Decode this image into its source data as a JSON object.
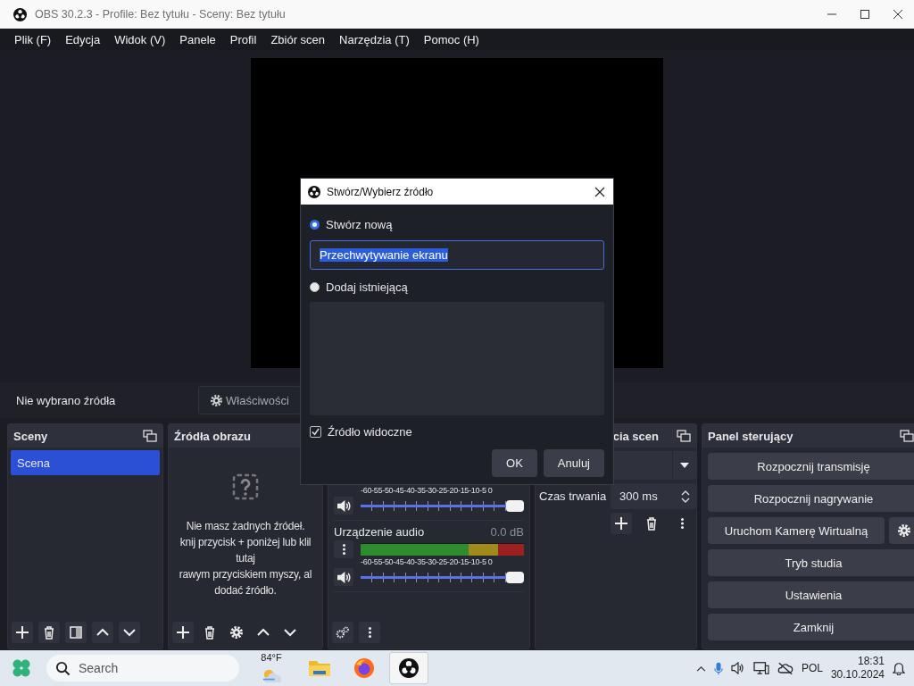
{
  "window": {
    "title": "OBS 30.2.3 - Profile: Bez tytułu - Sceny: Bez tytułu"
  },
  "menu": [
    "Plik (F)",
    "Edycja",
    "Widok (V)",
    "Panele",
    "Profil",
    "Zbiór scen",
    "Narzędzia (T)",
    "Pomoc (H)"
  ],
  "source_bar": {
    "status": "Nie wybrano źródła",
    "properties_button": "Właściwości"
  },
  "scenes": {
    "title": "Sceny",
    "items": [
      {
        "label": "Scena",
        "selected": true
      }
    ]
  },
  "sources": {
    "title": "Źródła obrazu",
    "empty_lines": [
      "Nie masz żadnych źródeł.",
      "knij przycisk + poniżej lub klil",
      "tutaj",
      "rawym przyciskiem myszy, al",
      "dodać źródło."
    ]
  },
  "mixer": {
    "channels": [
      {
        "scale": "-60-55-50-45-40-35-30-25-20-15-10-5 0",
        "level": 1
      },
      {
        "name": "Urządzenie audio",
        "reading": "0.0 dB",
        "scale": "-60-55-50-45-40-35-30-25-20-15-10-5 0",
        "level": 1
      }
    ]
  },
  "transitions": {
    "title": "cia scen",
    "duration_label": "Czas trwania",
    "duration": "300 ms"
  },
  "controls": {
    "title": "Panel sterujący",
    "buttons": [
      {
        "label": "Rozpocznij transmisję",
        "settings": false
      },
      {
        "label": "Rozpocznij nagrywanie",
        "settings": false
      },
      {
        "label": "Uruchom Kamerę Wirtualną",
        "settings": true
      },
      {
        "label": "Tryb studia",
        "settings": false
      },
      {
        "label": "Ustawienia",
        "settings": false
      },
      {
        "label": "Zamknij",
        "settings": false
      }
    ]
  },
  "dialog": {
    "title": "Stwórz/Wybierz źródło",
    "options": [
      {
        "label": "Stwórz nową",
        "selected": true
      },
      {
        "label": "Dodaj istniejącą",
        "selected": false
      }
    ],
    "name_value": "Przechwytywanie ekranu",
    "visible_checkbox": {
      "label": "Źródło widoczne",
      "checked": true
    },
    "buttons": [
      "OK",
      "Anuluj"
    ]
  },
  "taskbar": {
    "search_placeholder": "Search",
    "weather": "84°F",
    "apps": [
      {
        "kind": "folder",
        "selected": false
      },
      {
        "kind": "browser",
        "selected": false
      },
      {
        "kind": "obs",
        "selected": true
      }
    ],
    "language": "POL",
    "time": "18:31",
    "date": "30.10.2024"
  }
}
